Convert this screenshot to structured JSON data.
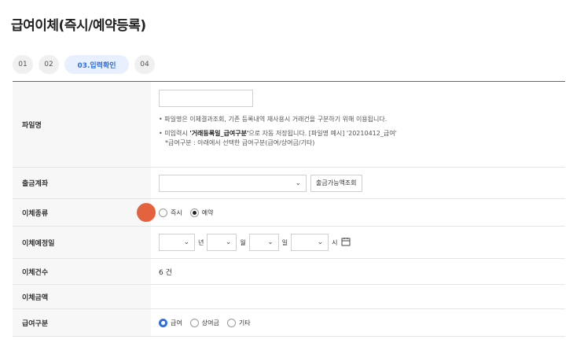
{
  "page": {
    "title": "급여이체(즉시/예약등록)"
  },
  "steps": [
    "01",
    "02",
    "03.입력확인",
    "04"
  ],
  "form": {
    "file_label": "파일명",
    "file_notes": {
      "n1": "• 파일명은 이체결과조회, 기존 등록내역 재사용시 거래건을 구분하기 위해 이용됩니다.",
      "n2_pre": "• 미입력시 ",
      "n2_bold": "'거래등록일_급여구분'",
      "n2_post": "으로 자동 저장됩니다. [파일명 예시] '20210412_급여'",
      "n3": "*급여구분 : 아래에서 선택한 급여구분(급여/상여금/기타)"
    },
    "account_label": "출금계좌",
    "balance_button": "출금가능액조회",
    "type_label": "이체종류",
    "type_options": [
      "즉시",
      "예약"
    ],
    "type_selected": "예약",
    "date_label": "이체예정일",
    "date_units": {
      "year": "년",
      "month": "월",
      "day": "일",
      "hour": "시"
    },
    "count_label": "이체건수",
    "count_value": "6 건",
    "amount_label": "이체금액",
    "amount_value": "",
    "kind_label": "급여구분",
    "kind_options": [
      "급여",
      "상여금",
      "기타"
    ],
    "kind_selected": "급여"
  },
  "colors": {
    "accent": "#2f6fe0",
    "marker": "#e5623e"
  },
  "icons": {
    "calendar": "calendar-icon",
    "chevron": "chevron-down-icon"
  }
}
